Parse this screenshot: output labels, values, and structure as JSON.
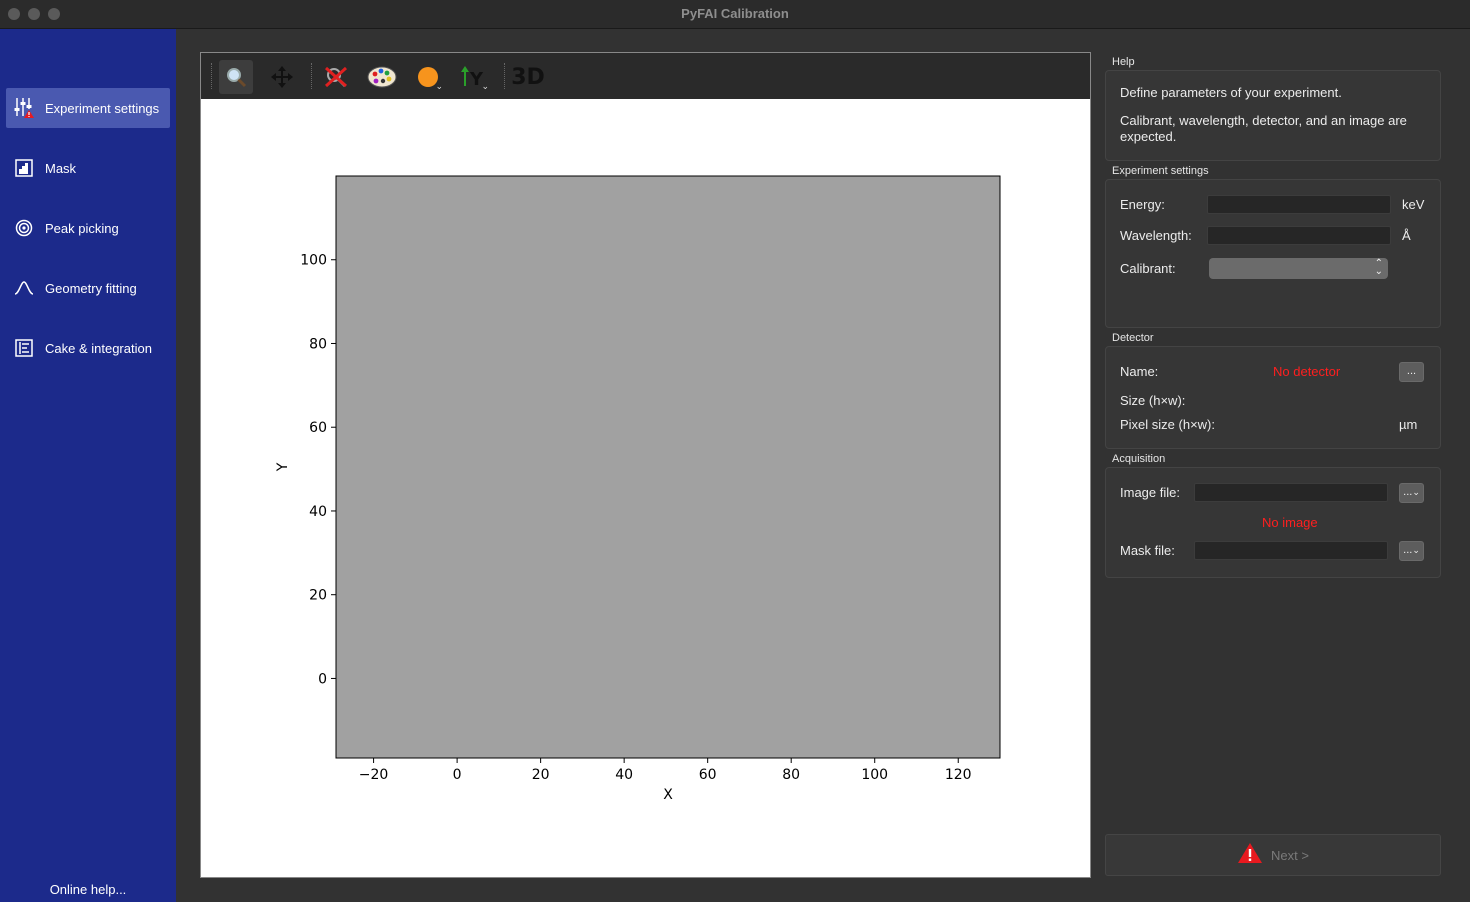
{
  "window": {
    "title": "PyFAI Calibration"
  },
  "sidebar": {
    "items": [
      {
        "label": "Experiment settings",
        "icon": "sliders-warning-icon"
      },
      {
        "label": "Mask",
        "icon": "mask-icon"
      },
      {
        "label": "Peak picking",
        "icon": "rings-icon"
      },
      {
        "label": "Geometry fitting",
        "icon": "peak-curve-icon"
      },
      {
        "label": "Cake & integration",
        "icon": "integration-icon"
      }
    ],
    "online_help": "Online help...",
    "background": "#1c2a8b"
  },
  "toolbar": {
    "items": [
      "zoom-icon",
      "pan-icon",
      "reset-zoom-icon",
      "colormap-icon",
      "mask-color-icon",
      "y-axis-icon",
      "3d-icon"
    ],
    "label_3d": "3D"
  },
  "plot": {
    "xlabel": "X",
    "ylabel": "Y"
  },
  "chart_data": {
    "type": "heatmap",
    "title": "",
    "xlabel": "X",
    "ylabel": "Y",
    "xlim": [
      -29,
      130
    ],
    "ylim": [
      -19,
      120
    ],
    "x_ticks": [
      -20,
      0,
      20,
      40,
      60,
      80,
      100,
      120
    ],
    "y_ticks": [
      0,
      20,
      40,
      60,
      80,
      100
    ],
    "x_tick_labels": [
      "−20",
      "0",
      "20",
      "40",
      "60",
      "80",
      "100",
      "120"
    ],
    "y_tick_labels": [
      "0",
      "20",
      "40",
      "60",
      "80",
      "100"
    ],
    "fill_color": "#a1a1a1",
    "grid": false
  },
  "help": {
    "title": "Help",
    "line1": "Define parameters of your experiment.",
    "line2": "Calibrant, wavelength, detector, and an image are expected."
  },
  "experiment": {
    "title": "Experiment settings",
    "energy_label": "Energy:",
    "energy_value": "",
    "energy_unit": "keV",
    "wavelength_label": "Wavelength:",
    "wavelength_value": "",
    "wavelength_unit": "Å",
    "calibrant_label": "Calibrant:",
    "calibrant_value": ""
  },
  "detector": {
    "title": "Detector",
    "name_label": "Name:",
    "name_value": "No detector",
    "browse_label": "...",
    "size_label": "Size (h×w):",
    "pixel_label": "Pixel size (h×w):",
    "pixel_unit": "µm"
  },
  "acquisition": {
    "title": "Acquisition",
    "image_label": "Image file:",
    "image_value": "",
    "image_status": "No image",
    "image_browse": "...",
    "mask_label": "Mask file:",
    "mask_value": "",
    "mask_browse": "..."
  },
  "footer": {
    "next_label": "Next >"
  },
  "colors": {
    "warning": "#e8191f",
    "error_text": "#ff1f1f"
  }
}
